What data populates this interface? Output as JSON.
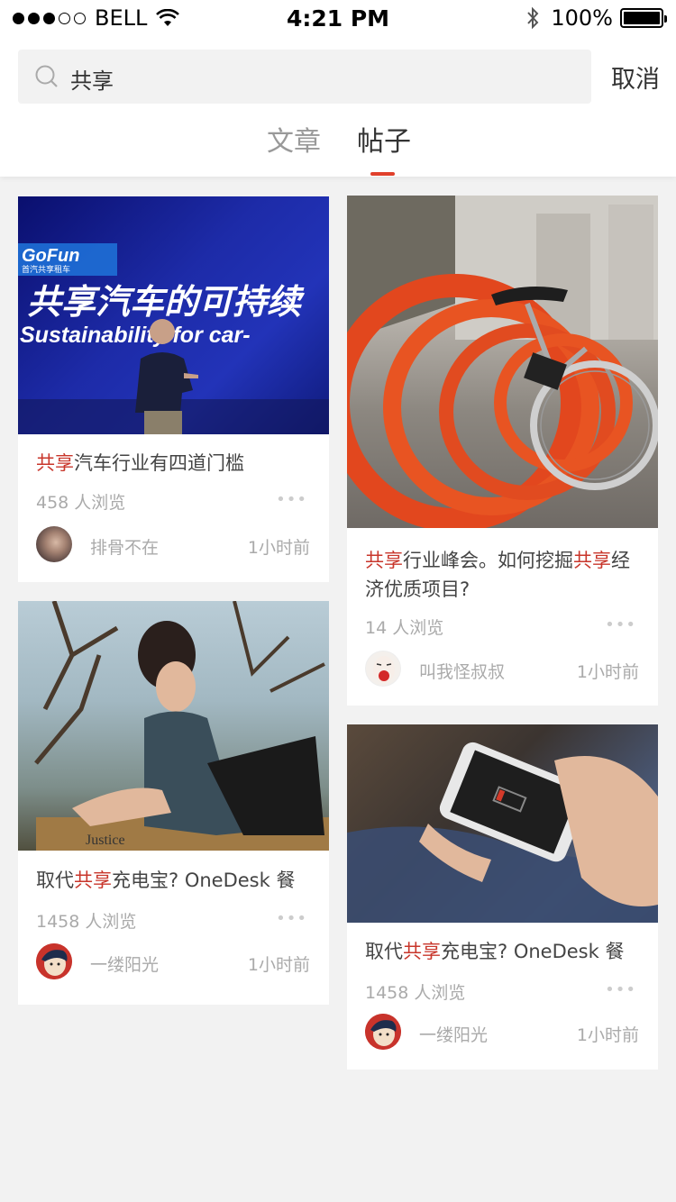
{
  "status_bar": {
    "carrier": "BELL",
    "time": "4:21 PM",
    "battery": "100%"
  },
  "search": {
    "query": "共享",
    "cancel_label": "取消"
  },
  "tabs": [
    {
      "label": "文章",
      "active": false
    },
    {
      "label": "帖子",
      "active": true
    }
  ],
  "colors": {
    "accent": "#e0402b",
    "highlight": "#c8362b"
  },
  "posts": [
    {
      "title_parts": [
        "共享",
        "汽车行业有四道门槛"
      ],
      "image_text": {
        "logo": "GoFun",
        "logo_sub": "首汽共享租车",
        "headline_cn": "共享汽车的可持续",
        "headline_en": "Sustainability for car-"
      },
      "views": "458 人浏览",
      "more": "•••",
      "author": "排骨不在",
      "time": "1小时前"
    },
    {
      "title_parts": [
        "共享",
        "行业峰会。如何挖掘",
        "共享",
        "经济优质项目?"
      ],
      "views": "14 人浏览",
      "more": "•••",
      "author": "叫我怪叔叔",
      "time": "1小时前"
    },
    {
      "title_parts": [
        "取代",
        "共享",
        "充电宝? OneDesk 餐"
      ],
      "image_text": {
        "sign": "Justice"
      },
      "views": "1458 人浏览",
      "more": "•••",
      "author": "一缕阳光",
      "time": "1小时前"
    },
    {
      "title_parts": [
        "取代",
        "共享",
        "充电宝? OneDesk 餐"
      ],
      "views": "1458 人浏览",
      "more": "•••",
      "author": "一缕阳光",
      "time": "1小时前"
    }
  ]
}
